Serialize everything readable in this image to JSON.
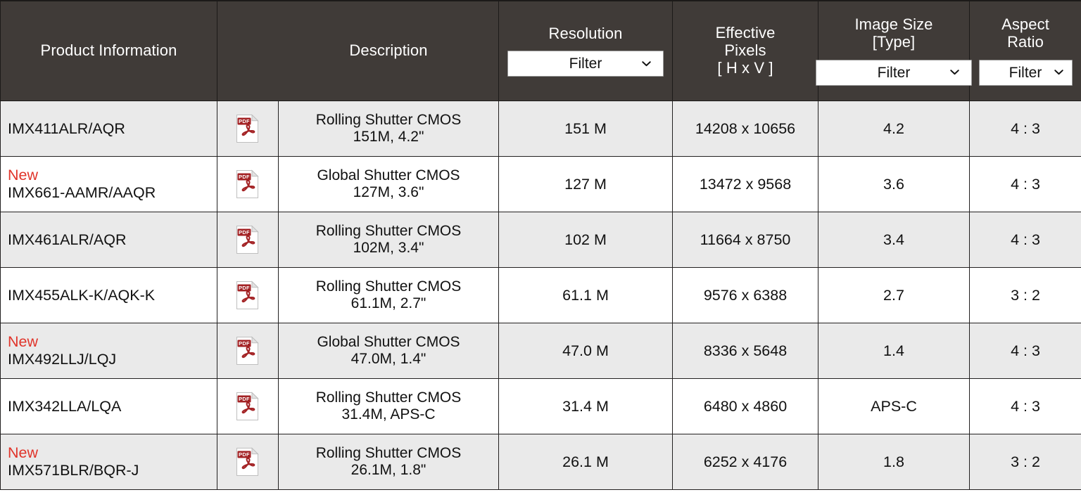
{
  "table": {
    "columns": [
      {
        "key": "product",
        "title": "Product Information",
        "filter": null
      },
      {
        "key": "pdf",
        "title": "",
        "filter": null
      },
      {
        "key": "description",
        "title": "Description",
        "filter": null
      },
      {
        "key": "resolution",
        "title": "Resolution",
        "filter": "Filter"
      },
      {
        "key": "effective_pixels",
        "title": "Effective\nPixels\n[ H x V ]",
        "filter": null
      },
      {
        "key": "image_size",
        "title": "Image Size\n[Type]",
        "filter": "Filter"
      },
      {
        "key": "aspect_ratio",
        "title": "Aspect\nRatio",
        "filter": "Filter"
      }
    ],
    "header": {
      "product_information": "Product Information",
      "description": "Description",
      "resolution": "Resolution",
      "effective_pixels": "Effective\nPixels\n[ H x V ]",
      "image_size": "Image Size\n[Type]",
      "aspect_ratio": "Aspect\nRatio",
      "filter_label": "Filter",
      "filter_options": [
        "Filter"
      ]
    },
    "rows": [
      {
        "new": false,
        "new_label": "",
        "product": "IMX411ALR/AQR",
        "pdf_icon": "pdf-file-icon",
        "description": "Rolling Shutter CMOS\n151M, 4.2\"",
        "resolution": "151 M",
        "effective_pixels": "14208 x 10656",
        "image_size": "4.2",
        "aspect_ratio": "4 : 3"
      },
      {
        "new": true,
        "new_label": "New",
        "product": "IMX661-AAMR/AAQR",
        "pdf_icon": "pdf-file-icon",
        "description": "Global Shutter CMOS\n127M, 3.6\"",
        "resolution": "127 M",
        "effective_pixels": "13472 x 9568",
        "image_size": "3.6",
        "aspect_ratio": "4 : 3"
      },
      {
        "new": false,
        "new_label": "",
        "product": "IMX461ALR/AQR",
        "pdf_icon": "pdf-file-icon",
        "description": "Rolling Shutter CMOS\n102M, 3.4\"",
        "resolution": "102 M",
        "effective_pixels": "11664 x 8750",
        "image_size": "3.4",
        "aspect_ratio": "4 : 3"
      },
      {
        "new": false,
        "new_label": "",
        "product": "IMX455ALK-K/AQK-K",
        "pdf_icon": "pdf-file-icon",
        "description": "Rolling Shutter CMOS\n61.1M, 2.7\"",
        "resolution": "61.1 M",
        "effective_pixels": "9576 x 6388",
        "image_size": "2.7",
        "aspect_ratio": "3 : 2"
      },
      {
        "new": true,
        "new_label": "New",
        "product": "IMX492LLJ/LQJ",
        "pdf_icon": "pdf-file-icon",
        "description": "Global Shutter CMOS\n47.0M, 1.4\"",
        "resolution": "47.0 M",
        "effective_pixels": "8336 x 5648",
        "image_size": "1.4",
        "aspect_ratio": "4 : 3"
      },
      {
        "new": false,
        "new_label": "",
        "product": "IMX342LLA/LQA",
        "pdf_icon": "pdf-file-icon",
        "description": "Rolling Shutter CMOS\n31.4M, APS-C",
        "resolution": "31.4 M",
        "effective_pixels": "6480 x 4860",
        "image_size": "APS-C",
        "aspect_ratio": "4 : 3"
      },
      {
        "new": true,
        "new_label": "New",
        "product": "IMX571BLR/BQR-J",
        "pdf_icon": "pdf-file-icon",
        "description": "Rolling Shutter CMOS\n26.1M, 1.8\"",
        "resolution": "26.1 M",
        "effective_pixels": "6252 x 4176",
        "image_size": "1.8",
        "aspect_ratio": "3 : 2"
      }
    ]
  },
  "colors": {
    "header_background": "#403B38",
    "header_text": "#FFFFFF",
    "row_alt_background": "#EAEAEA",
    "row_background": "#FFFFFF",
    "border": "#222020",
    "new_badge": "#E0342A",
    "pdf_icon_red": "#A32224"
  }
}
